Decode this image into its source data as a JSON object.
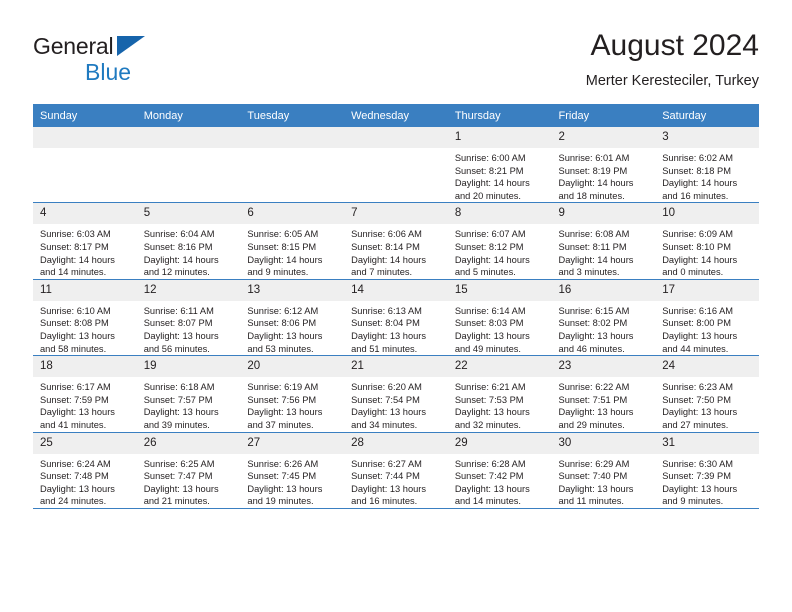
{
  "brand": {
    "name_part1": "General",
    "name_part2": "Blue",
    "logo_icon": "triangle-icon",
    "accent_color": "#1f7ac0",
    "header_color": "#3a7fc1"
  },
  "header": {
    "title": "August 2024",
    "subtitle": "Merter Keresteciler, Turkey"
  },
  "weekdays": [
    "Sunday",
    "Monday",
    "Tuesday",
    "Wednesday",
    "Thursday",
    "Friday",
    "Saturday"
  ],
  "weeks": [
    [
      {
        "day": "",
        "lines": []
      },
      {
        "day": "",
        "lines": []
      },
      {
        "day": "",
        "lines": []
      },
      {
        "day": "",
        "lines": []
      },
      {
        "day": "1",
        "lines": [
          "Sunrise: 6:00 AM",
          "Sunset: 8:21 PM",
          "Daylight: 14 hours",
          "and 20 minutes."
        ]
      },
      {
        "day": "2",
        "lines": [
          "Sunrise: 6:01 AM",
          "Sunset: 8:19 PM",
          "Daylight: 14 hours",
          "and 18 minutes."
        ]
      },
      {
        "day": "3",
        "lines": [
          "Sunrise: 6:02 AM",
          "Sunset: 8:18 PM",
          "Daylight: 14 hours",
          "and 16 minutes."
        ]
      }
    ],
    [
      {
        "day": "4",
        "lines": [
          "Sunrise: 6:03 AM",
          "Sunset: 8:17 PM",
          "Daylight: 14 hours",
          "and 14 minutes."
        ]
      },
      {
        "day": "5",
        "lines": [
          "Sunrise: 6:04 AM",
          "Sunset: 8:16 PM",
          "Daylight: 14 hours",
          "and 12 minutes."
        ]
      },
      {
        "day": "6",
        "lines": [
          "Sunrise: 6:05 AM",
          "Sunset: 8:15 PM",
          "Daylight: 14 hours",
          "and 9 minutes."
        ]
      },
      {
        "day": "7",
        "lines": [
          "Sunrise: 6:06 AM",
          "Sunset: 8:14 PM",
          "Daylight: 14 hours",
          "and 7 minutes."
        ]
      },
      {
        "day": "8",
        "lines": [
          "Sunrise: 6:07 AM",
          "Sunset: 8:12 PM",
          "Daylight: 14 hours",
          "and 5 minutes."
        ]
      },
      {
        "day": "9",
        "lines": [
          "Sunrise: 6:08 AM",
          "Sunset: 8:11 PM",
          "Daylight: 14 hours",
          "and 3 minutes."
        ]
      },
      {
        "day": "10",
        "lines": [
          "Sunrise: 6:09 AM",
          "Sunset: 8:10 PM",
          "Daylight: 14 hours",
          "and 0 minutes."
        ]
      }
    ],
    [
      {
        "day": "11",
        "lines": [
          "Sunrise: 6:10 AM",
          "Sunset: 8:08 PM",
          "Daylight: 13 hours",
          "and 58 minutes."
        ]
      },
      {
        "day": "12",
        "lines": [
          "Sunrise: 6:11 AM",
          "Sunset: 8:07 PM",
          "Daylight: 13 hours",
          "and 56 minutes."
        ]
      },
      {
        "day": "13",
        "lines": [
          "Sunrise: 6:12 AM",
          "Sunset: 8:06 PM",
          "Daylight: 13 hours",
          "and 53 minutes."
        ]
      },
      {
        "day": "14",
        "lines": [
          "Sunrise: 6:13 AM",
          "Sunset: 8:04 PM",
          "Daylight: 13 hours",
          "and 51 minutes."
        ]
      },
      {
        "day": "15",
        "lines": [
          "Sunrise: 6:14 AM",
          "Sunset: 8:03 PM",
          "Daylight: 13 hours",
          "and 49 minutes."
        ]
      },
      {
        "day": "16",
        "lines": [
          "Sunrise: 6:15 AM",
          "Sunset: 8:02 PM",
          "Daylight: 13 hours",
          "and 46 minutes."
        ]
      },
      {
        "day": "17",
        "lines": [
          "Sunrise: 6:16 AM",
          "Sunset: 8:00 PM",
          "Daylight: 13 hours",
          "and 44 minutes."
        ]
      }
    ],
    [
      {
        "day": "18",
        "lines": [
          "Sunrise: 6:17 AM",
          "Sunset: 7:59 PM",
          "Daylight: 13 hours",
          "and 41 minutes."
        ]
      },
      {
        "day": "19",
        "lines": [
          "Sunrise: 6:18 AM",
          "Sunset: 7:57 PM",
          "Daylight: 13 hours",
          "and 39 minutes."
        ]
      },
      {
        "day": "20",
        "lines": [
          "Sunrise: 6:19 AM",
          "Sunset: 7:56 PM",
          "Daylight: 13 hours",
          "and 37 minutes."
        ]
      },
      {
        "day": "21",
        "lines": [
          "Sunrise: 6:20 AM",
          "Sunset: 7:54 PM",
          "Daylight: 13 hours",
          "and 34 minutes."
        ]
      },
      {
        "day": "22",
        "lines": [
          "Sunrise: 6:21 AM",
          "Sunset: 7:53 PM",
          "Daylight: 13 hours",
          "and 32 minutes."
        ]
      },
      {
        "day": "23",
        "lines": [
          "Sunrise: 6:22 AM",
          "Sunset: 7:51 PM",
          "Daylight: 13 hours",
          "and 29 minutes."
        ]
      },
      {
        "day": "24",
        "lines": [
          "Sunrise: 6:23 AM",
          "Sunset: 7:50 PM",
          "Daylight: 13 hours",
          "and 27 minutes."
        ]
      }
    ],
    [
      {
        "day": "25",
        "lines": [
          "Sunrise: 6:24 AM",
          "Sunset: 7:48 PM",
          "Daylight: 13 hours",
          "and 24 minutes."
        ]
      },
      {
        "day": "26",
        "lines": [
          "Sunrise: 6:25 AM",
          "Sunset: 7:47 PM",
          "Daylight: 13 hours",
          "and 21 minutes."
        ]
      },
      {
        "day": "27",
        "lines": [
          "Sunrise: 6:26 AM",
          "Sunset: 7:45 PM",
          "Daylight: 13 hours",
          "and 19 minutes."
        ]
      },
      {
        "day": "28",
        "lines": [
          "Sunrise: 6:27 AM",
          "Sunset: 7:44 PM",
          "Daylight: 13 hours",
          "and 16 minutes."
        ]
      },
      {
        "day": "29",
        "lines": [
          "Sunrise: 6:28 AM",
          "Sunset: 7:42 PM",
          "Daylight: 13 hours",
          "and 14 minutes."
        ]
      },
      {
        "day": "30",
        "lines": [
          "Sunrise: 6:29 AM",
          "Sunset: 7:40 PM",
          "Daylight: 13 hours",
          "and 11 minutes."
        ]
      },
      {
        "day": "31",
        "lines": [
          "Sunrise: 6:30 AM",
          "Sunset: 7:39 PM",
          "Daylight: 13 hours",
          "and 9 minutes."
        ]
      }
    ]
  ]
}
